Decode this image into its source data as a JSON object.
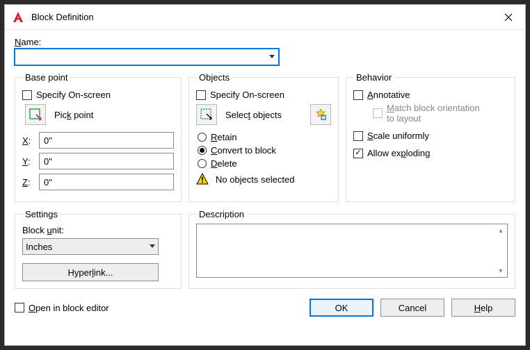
{
  "title": "Block Definition",
  "name": {
    "label": "Name:",
    "value": ""
  },
  "basepoint": {
    "legend": "Base point",
    "specify": {
      "label": "Specify On-screen",
      "checked": false
    },
    "pickpoint": "Pick point",
    "x": {
      "label": "X:",
      "value": "0\""
    },
    "y": {
      "label": "Y:",
      "value": "0\""
    },
    "z": {
      "label": "Z:",
      "value": "0\""
    }
  },
  "objects": {
    "legend": "Objects",
    "specify": {
      "label": "Specify On-screen",
      "checked": false
    },
    "select": "Select objects",
    "retain": "Retain",
    "convert": "Convert to block",
    "delete": "Delete",
    "selected_radio": "convert",
    "warning": "No objects selected"
  },
  "behavior": {
    "legend": "Behavior",
    "annotative": {
      "label": "Annotative",
      "checked": false
    },
    "match": {
      "label1": "Match block orientation",
      "label2": "to layout",
      "checked": false,
      "disabled": true
    },
    "scale": {
      "label": "Scale uniformly",
      "checked": false
    },
    "explode": {
      "label": "Allow exploding",
      "checked": true
    }
  },
  "settings": {
    "legend": "Settings",
    "unit_label": "Block unit:",
    "unit_value": "Inches",
    "hyperlink": "Hyperlink..."
  },
  "description": {
    "legend": "Description",
    "value": ""
  },
  "footer": {
    "open_editor": {
      "label": "Open in block editor",
      "checked": false
    },
    "ok": "OK",
    "cancel": "Cancel",
    "help": "Help"
  }
}
